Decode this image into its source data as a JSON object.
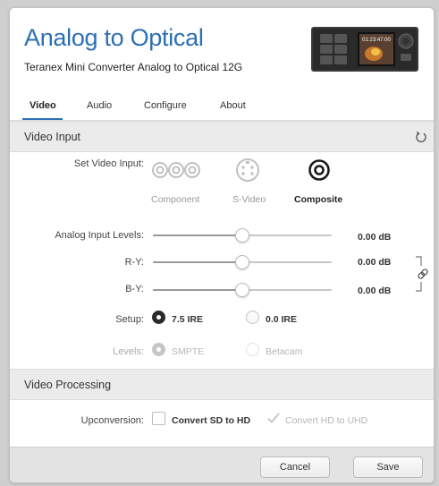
{
  "header": {
    "title": "Analog to Optical",
    "subtitle": "Teranex Mini Converter Analog to Optical 12G",
    "device_display": "01:23:47:00"
  },
  "tabs": [
    {
      "label": "Video",
      "active": true
    },
    {
      "label": "Audio",
      "active": false
    },
    {
      "label": "Configure",
      "active": false
    },
    {
      "label": "About",
      "active": false
    }
  ],
  "video_input": {
    "section_title": "Video Input",
    "set_input_label": "Set Video Input:",
    "options": [
      {
        "label": "Component",
        "icon": "component-connector-icon",
        "selected": false
      },
      {
        "label": "S-Video",
        "icon": "svideo-connector-icon",
        "selected": false
      },
      {
        "label": "Composite",
        "icon": "composite-connector-icon",
        "selected": true
      }
    ],
    "levels": [
      {
        "label": "Analog Input Levels:",
        "value": "0.00 dB",
        "position": 0.5
      },
      {
        "label": "R-Y:",
        "value": "0.00 dB",
        "position": 0.5
      },
      {
        "label": "B-Y:",
        "value": "0.00 dB",
        "position": 0.5
      }
    ],
    "setup": {
      "label": "Setup:",
      "options": [
        {
          "label": "7.5 IRE",
          "selected": true
        },
        {
          "label": "0.0 IRE",
          "selected": false
        }
      ]
    },
    "levels_standard": {
      "label": "Levels:",
      "disabled": true,
      "options": [
        {
          "label": "SMPTE",
          "selected": true
        },
        {
          "label": "Betacam",
          "selected": false
        }
      ]
    }
  },
  "video_processing": {
    "section_title": "Video Processing",
    "upconversion_label": "Upconversion:",
    "options": [
      {
        "label": "Convert SD to HD",
        "checked": false,
        "disabled": false
      },
      {
        "label": "Convert HD to UHD",
        "checked": true,
        "disabled": true
      }
    ]
  },
  "footer": {
    "cancel_label": "Cancel",
    "save_label": "Save"
  },
  "colors": {
    "accent": "#2c6fb3",
    "section_bg": "#ebebeb",
    "footer_bg": "#e3e3e3"
  }
}
